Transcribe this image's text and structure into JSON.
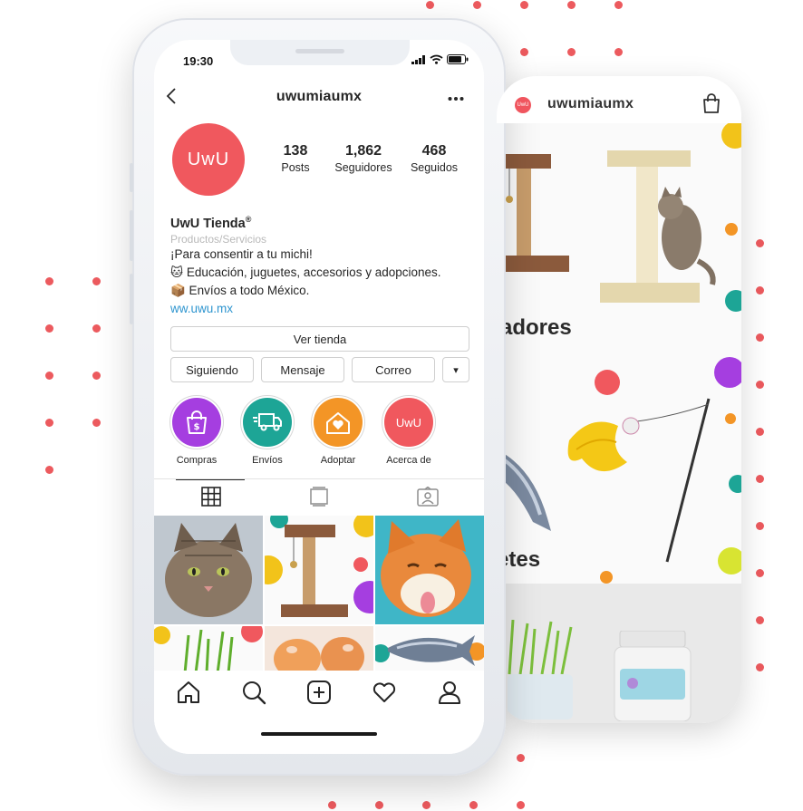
{
  "colors": {
    "brand": "#f0585e",
    "link": "#2e95cf",
    "dots": "#ec5a5e",
    "purple": "#a53ee0",
    "teal": "#1da596",
    "orange": "#f39526",
    "pink": "#f0585e"
  },
  "back_screen": {
    "username": "uwumiaumx",
    "logo_text": "UwU",
    "section_1_title": "adores",
    "section_2_title": "etes",
    "bag_icon": "shopping-bag-icon"
  },
  "status_bar": {
    "time": "19:30",
    "icons": [
      "signal-icon",
      "wifi-icon",
      "battery-icon"
    ]
  },
  "profile": {
    "username": "uwumiaumx",
    "avatar_text": "UwU",
    "stats": [
      {
        "number": "138",
        "label": "Posts"
      },
      {
        "number": "1,862",
        "label": "Seguidores"
      },
      {
        "number": "468",
        "label": "Seguidos"
      }
    ],
    "bio": {
      "name": "UwU Tienda",
      "registered": "®",
      "category": "Productos/Servicios",
      "line1": "¡Para consentir a tu michi!",
      "line2": "🐱 Educación, juguetes, accesorios y adopciones.",
      "line3": "📦 Envíos a todo México.",
      "link": "ww.uwu.mx"
    },
    "buttons": {
      "shop": "Ver tienda",
      "following": "Siguiendo",
      "message": "Mensaje",
      "email": "Correo",
      "more": "▾"
    },
    "highlights": [
      {
        "label": "Compras",
        "color": "#a53ee0",
        "icon": "shopping-bag-icon"
      },
      {
        "label": "Envíos",
        "color": "#1da596",
        "icon": "truck-icon"
      },
      {
        "label": "Adoptar",
        "color": "#f39526",
        "icon": "heart-icon"
      },
      {
        "label": "Acerca de",
        "color": "#f0585e",
        "icon": "uwu-logo",
        "text": "UwU"
      }
    ]
  },
  "tabs": [
    "grid-icon",
    "igtv-icon",
    "tagged-icon"
  ],
  "bottom_nav": [
    "home-icon",
    "search-icon",
    "add-post-icon",
    "heart-icon",
    "profile-icon"
  ]
}
